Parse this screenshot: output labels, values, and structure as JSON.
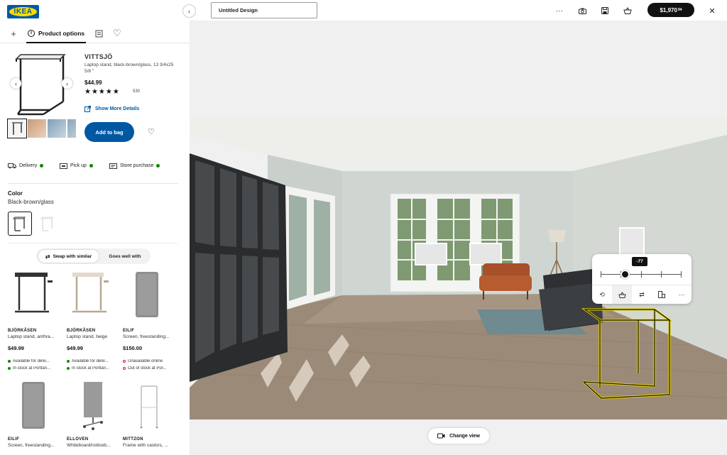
{
  "brand": {
    "logo_text": "IKEA",
    "blue": "#0058a3",
    "yellow": "#ffdb00"
  },
  "tabs": {
    "add_icon": "plus-icon",
    "product_options": "Product options",
    "list_icon": "list-icon",
    "favorites_icon": "heart-icon"
  },
  "product": {
    "name": "VITTSJÖ",
    "description": "Laptop stand, black-brown/glass, 13 3/4x25 5/8 \"",
    "price": "$44.99",
    "rating": 5,
    "review_count": "530",
    "more_details": "Show More Details",
    "add_to_bag": "Add to bag",
    "image_count": 4
  },
  "fulfillment": [
    {
      "label": "Delivery",
      "icon": "truck-icon"
    },
    {
      "label": "Pick up",
      "icon": "store-icon"
    },
    {
      "label": "Store purchase",
      "icon": "receipt-icon"
    }
  ],
  "color": {
    "label": "Color",
    "value": "Black-brown/glass"
  },
  "recommend": {
    "swap": "Swap with similar",
    "goes_well": "Goes well with"
  },
  "cards": [
    {
      "name": "BJÖRKÅSEN",
      "desc": "Laptop stand, anthra...",
      "price": "$49.99",
      "availability": "Available for deliv...",
      "stock": "In stock at Portlan...",
      "stock_ok": true
    },
    {
      "name": "BJÖRKÅSEN",
      "desc": "Laptop stand, beige",
      "price": "$49.99",
      "availability": "Available for deliv...",
      "stock": "In stock at Portlan...",
      "stock_ok": true
    },
    {
      "name": "EILIF",
      "desc": "Screen, freestanding...",
      "price": "$150.00",
      "availability": "Unavailable online",
      "stock": "Out of stock at Por...",
      "stock_ok": false
    },
    {
      "name": "EILIF",
      "desc": "Screen, freestanding..."
    },
    {
      "name": "ELLOVEN",
      "desc": "Whiteboard/noticeb..."
    },
    {
      "name": "MITTZON",
      "desc": "Frame with castors, ..."
    }
  ],
  "topbar": {
    "design_name": "Untitled Design",
    "total": "$1,970",
    "total_cents": "94",
    "icons": [
      "more-icon",
      "camera-icon",
      "save-icon",
      "bag-icon",
      "close-icon"
    ]
  },
  "view": {
    "change_view": "Change view",
    "rotation_value": "-77",
    "rotation_fraction": 0.3,
    "tools": [
      "rotate-icon",
      "price-icon",
      "swap-icon",
      "measure-icon",
      "more-icon"
    ]
  }
}
